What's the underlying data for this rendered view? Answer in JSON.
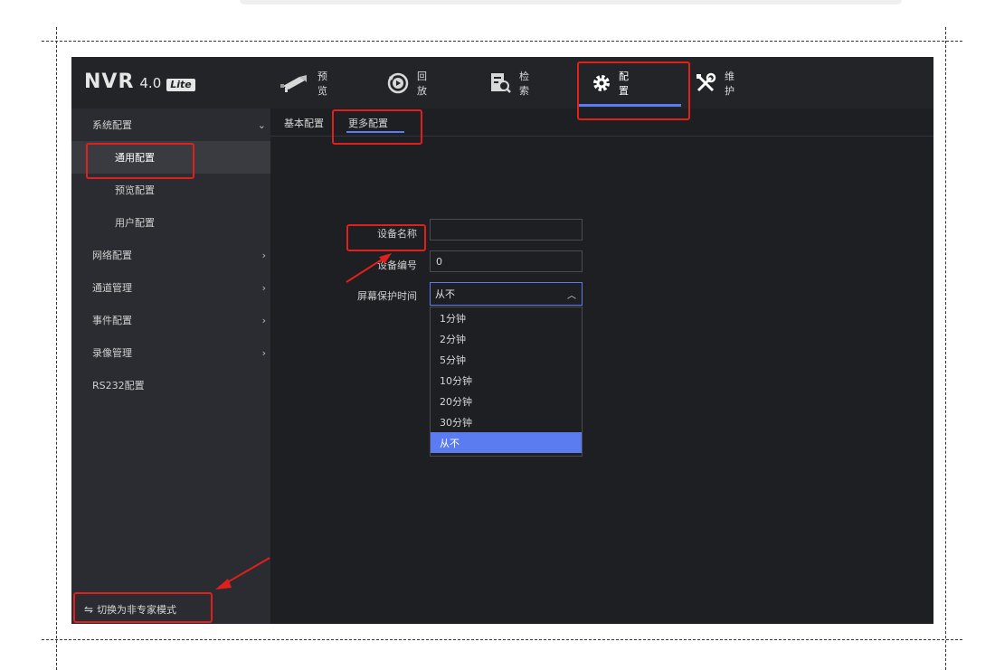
{
  "app": {
    "logo_text": "NVR",
    "version": "4.0",
    "edition": "Lite"
  },
  "nav": {
    "items": [
      {
        "label": "预览",
        "icon": "camera-icon"
      },
      {
        "label": "回放",
        "icon": "playback-icon"
      },
      {
        "label": "检索",
        "icon": "search-doc-icon"
      },
      {
        "label": "配置",
        "icon": "gear-icon",
        "active": true
      },
      {
        "label": "维护",
        "icon": "tools-icon"
      }
    ]
  },
  "sidebar": {
    "items": [
      {
        "label": "系统配置",
        "chevron": "⌄",
        "expanded": true
      },
      {
        "label": "通用配置",
        "active": true
      },
      {
        "label": "预览配置"
      },
      {
        "label": "用户配置"
      },
      {
        "label": "网络配置",
        "chevron": "›"
      },
      {
        "label": "通道管理",
        "chevron": "›"
      },
      {
        "label": "事件配置",
        "chevron": "›"
      },
      {
        "label": "录像管理",
        "chevron": "›"
      },
      {
        "label": "RS232配置"
      }
    ],
    "footer_label": "切换为非专家模式",
    "footer_icon": "⇋"
  },
  "tabs": [
    {
      "label": "基本配置"
    },
    {
      "label": "更多配置",
      "active": true
    }
  ],
  "form": {
    "device_name_label": "设备名称",
    "device_name_value": "",
    "device_number_label": "设备编号",
    "device_number_value": "0",
    "screensaver_label": "屏幕保护时间",
    "screensaver_value": "从不",
    "screensaver_options": [
      "1分钟",
      "2分钟",
      "5分钟",
      "10分钟",
      "20分钟",
      "30分钟",
      "从不"
    ]
  },
  "colors": {
    "accent": "#5b7cf0",
    "annotation": "#e0201c",
    "background": "#1e1f23",
    "sidebar": "#2b2c31"
  }
}
